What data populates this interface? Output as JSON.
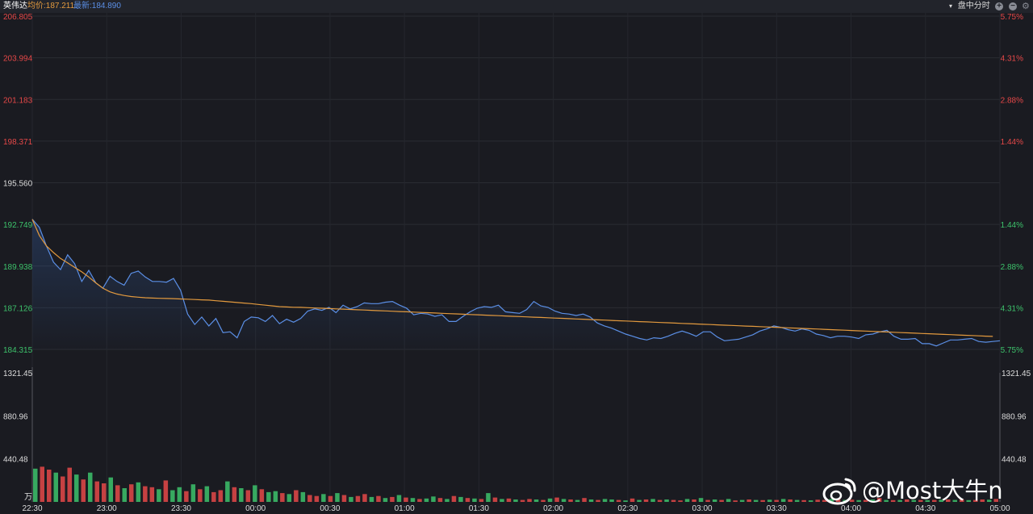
{
  "header": {
    "stock_name": "英伟达",
    "avg_label": "均价:187.211",
    "last_label": "最新:184.890",
    "mode_label": "盘中分时"
  },
  "watermark": "@Most大牛n",
  "colors": {
    "background": "#1a1b21",
    "price_line": "#5b8fe6",
    "avg_line": "#e39a3e",
    "up": "#e54848",
    "down": "#3dc26b",
    "neutral_text": "#dcdcdc"
  },
  "chart_data": [
    {
      "type": "line",
      "x_ticks": [
        "22:30",
        "23:00",
        "23:30",
        "00:00",
        "00:30",
        "01:00",
        "01:30",
        "02:00",
        "02:30",
        "03:00",
        "03:30",
        "04:00",
        "04:30",
        "05:00"
      ],
      "y_left_ticks": [
        "206.805",
        "203.994",
        "201.183",
        "198.371",
        "195.560",
        "192.749",
        "189.938",
        "187.126",
        "184.315"
      ],
      "y_right_ticks": [
        "5.75%",
        "4.31%",
        "2.88%",
        "1.44%",
        "",
        "1.44%",
        "2.88%",
        "4.31%",
        "5.75%"
      ],
      "ylim": [
        184.315,
        206.805
      ],
      "reference_price": 195.56,
      "series": [
        {
          "name": "最新",
          "values": [
            193.1,
            192.55,
            191.3,
            190.2,
            189.7,
            190.7,
            190.1,
            188.9,
            189.65,
            188.8,
            188.45,
            189.25,
            188.9,
            188.65,
            189.45,
            189.6,
            189.2,
            188.9,
            188.9,
            188.85,
            189.1,
            188.3,
            186.7,
            186.0,
            186.5,
            185.9,
            186.4,
            185.45,
            185.5,
            185.1,
            186.2,
            186.5,
            186.45,
            186.2,
            186.6,
            186.05,
            186.35,
            186.15,
            186.4,
            186.9,
            187.05,
            186.95,
            187.15,
            186.8,
            187.3,
            187.05,
            187.2,
            187.45,
            187.4,
            187.4,
            187.5,
            187.55,
            187.3,
            187.1,
            186.65,
            186.75,
            186.7,
            186.55,
            186.65,
            186.2,
            186.2,
            186.55,
            186.85,
            187.1,
            187.2,
            187.15,
            187.3,
            186.85,
            186.8,
            186.75,
            187.0,
            187.55,
            187.25,
            187.15,
            186.9,
            186.75,
            186.7,
            186.6,
            186.7,
            186.5,
            186.1,
            185.9,
            185.75,
            185.55,
            185.35,
            185.2,
            185.05,
            184.95,
            185.1,
            185.05,
            185.2,
            185.4,
            185.55,
            185.4,
            185.2,
            185.5,
            185.5,
            185.15,
            184.9,
            184.95,
            185.0,
            185.15,
            185.3,
            185.55,
            185.7,
            185.9,
            185.8,
            185.65,
            185.55,
            185.7,
            185.6,
            185.35,
            185.25,
            185.1,
            185.2,
            185.2,
            185.15,
            185.05,
            185.3,
            185.35,
            185.5,
            185.6,
            185.2,
            185.0,
            185.0,
            185.05,
            184.7,
            184.7,
            184.55,
            184.75,
            184.95,
            184.95,
            185.0,
            185.05,
            184.85,
            184.8,
            184.85,
            184.9
          ],
          "color": "#5b8fe6"
        },
        {
          "name": "均价",
          "values": [
            193.1,
            192.0,
            191.3,
            190.85,
            190.45,
            190.15,
            189.85,
            189.55,
            189.2,
            188.8,
            188.45,
            188.2,
            188.05,
            187.95,
            187.88,
            187.84,
            187.8,
            187.78,
            187.76,
            187.75,
            187.74,
            187.72,
            187.7,
            187.68,
            187.66,
            187.64,
            187.6,
            187.56,
            187.52,
            187.48,
            187.44,
            187.4,
            187.35,
            187.3,
            187.25,
            187.2,
            187.18,
            187.16,
            187.15,
            187.13,
            187.11,
            187.09,
            187.07,
            187.05,
            187.03,
            187.01,
            186.99,
            186.97,
            186.95,
            186.93,
            186.91,
            186.89,
            186.87,
            186.85,
            186.83,
            186.81,
            186.79,
            186.77,
            186.75,
            186.73,
            186.71,
            186.69,
            186.67,
            186.65,
            186.63,
            186.61,
            186.59,
            186.57,
            186.55,
            186.53,
            186.51,
            186.49,
            186.47,
            186.45,
            186.43,
            186.41,
            186.39,
            186.37,
            186.35,
            186.33,
            186.31,
            186.29,
            186.27,
            186.25,
            186.23,
            186.21,
            186.19,
            186.17,
            186.15,
            186.13,
            186.11,
            186.09,
            186.07,
            186.05,
            186.03,
            186.01,
            185.99,
            185.97,
            185.95,
            185.93,
            185.91,
            185.89,
            185.87,
            185.85,
            185.83,
            185.81,
            185.79,
            185.77,
            185.75,
            185.73,
            185.71,
            185.69,
            185.67,
            185.65,
            185.63,
            185.61,
            185.59,
            185.57,
            185.55,
            185.53,
            185.51,
            185.49,
            185.47,
            185.45,
            185.43,
            185.41,
            185.39,
            185.37,
            185.35,
            185.33,
            185.31,
            185.29,
            185.27,
            185.25,
            185.23,
            185.21,
            185.19
          ],
          "color": "#e39a3e"
        }
      ]
    },
    {
      "type": "bar",
      "y_ticks": [
        "1321.45",
        "880.96",
        "440.48"
      ],
      "unit": "万",
      "ylim": [
        0,
        1321.45
      ],
      "values": [
        340,
        360,
        330,
        300,
        260,
        350,
        280,
        230,
        300,
        210,
        190,
        250,
        170,
        140,
        180,
        200,
        160,
        150,
        130,
        220,
        120,
        150,
        110,
        180,
        130,
        160,
        100,
        120,
        210,
        150,
        140,
        120,
        170,
        130,
        100,
        110,
        90,
        80,
        120,
        100,
        70,
        60,
        80,
        60,
        90,
        70,
        50,
        60,
        80,
        50,
        60,
        40,
        50,
        70,
        45,
        40,
        30,
        35,
        55,
        40,
        30,
        60,
        50,
        40,
        35,
        30,
        90,
        45,
        30,
        35,
        25,
        20,
        30,
        25,
        20,
        35,
        45,
        30,
        25,
        20,
        40,
        25,
        20,
        30,
        25,
        20,
        15,
        35,
        20,
        25,
        30,
        20,
        25,
        20,
        15,
        30,
        25,
        40,
        20,
        25,
        20,
        30,
        15,
        20,
        25,
        20,
        18,
        22,
        20,
        30,
        25,
        20,
        18,
        16,
        22,
        20,
        30,
        25,
        20,
        22,
        18,
        20,
        25,
        40,
        20,
        18,
        20,
        25,
        20,
        20,
        18,
        20,
        22,
        25,
        20,
        24,
        18,
        20,
        25,
        22,
        30
      ],
      "directions": [
        "d",
        "u",
        "u",
        "d",
        "u",
        "u",
        "d",
        "u",
        "d",
        "u",
        "u",
        "d",
        "u",
        "d",
        "u",
        "d",
        "u",
        "u",
        "d",
        "u",
        "d",
        "d",
        "u",
        "d",
        "u",
        "d",
        "u",
        "u",
        "d",
        "u",
        "d",
        "u",
        "d",
        "u",
        "d",
        "d",
        "u",
        "d",
        "u",
        "d",
        "u",
        "u",
        "d",
        "u",
        "d",
        "u",
        "d",
        "u",
        "u",
        "d",
        "u",
        "d",
        "u",
        "d",
        "u",
        "d",
        "u",
        "d",
        "d",
        "u",
        "d",
        "u",
        "d",
        "u",
        "d",
        "u",
        "d",
        "u",
        "d",
        "u",
        "d",
        "u",
        "u",
        "d",
        "u",
        "d",
        "u",
        "d",
        "u",
        "d",
        "u",
        "d",
        "u",
        "d",
        "d",
        "u",
        "d",
        "u",
        "d",
        "u",
        "d",
        "u",
        "d",
        "u",
        "u",
        "d",
        "u",
        "d",
        "u",
        "d",
        "u",
        "d",
        "u",
        "d",
        "u",
        "d",
        "u",
        "d",
        "u",
        "d",
        "u",
        "d",
        "u",
        "d",
        "u",
        "u",
        "d",
        "u",
        "d",
        "u",
        "d",
        "u",
        "d",
        "u",
        "d",
        "u",
        "d",
        "u",
        "d",
        "u",
        "d",
        "u",
        "d",
        "u",
        "d",
        "u",
        "d",
        "u",
        "u",
        "d",
        "u",
        "d",
        "u",
        "d",
        "u",
        "d",
        "u",
        "d"
      ]
    }
  ]
}
